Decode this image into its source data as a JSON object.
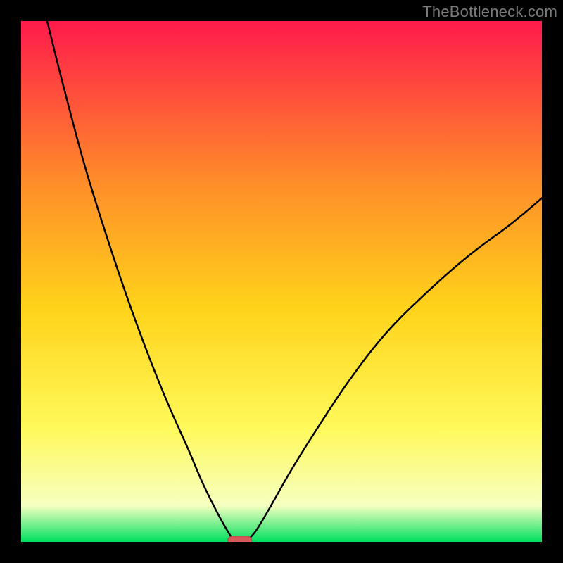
{
  "watermark": "TheBottleneck.com",
  "colors": {
    "gradient_top": "#ff1a4b",
    "gradient_upper_mid": "#ff8a2a",
    "gradient_mid": "#ffd31a",
    "gradient_lower_mid": "#fff95a",
    "gradient_near_bottom": "#f6ffc0",
    "gradient_bottom": "#00e060",
    "curve": "#000000",
    "marker_fill": "#d65a5a",
    "marker_stroke": "#b24848",
    "frame": "#000000"
  },
  "chart_data": {
    "type": "line",
    "title": "",
    "xlabel": "",
    "ylabel": "",
    "xlim": [
      0,
      100
    ],
    "ylim": [
      0,
      100
    ],
    "grid": false,
    "series": [
      {
        "name": "left-branch",
        "x": [
          5,
          8,
          12,
          16,
          20,
          24,
          28,
          32,
          35,
          38,
          40,
          41
        ],
        "y": [
          100,
          88,
          73,
          60,
          48,
          37,
          27,
          18,
          11,
          5,
          1.5,
          0
        ]
      },
      {
        "name": "right-branch",
        "x": [
          43,
          45,
          48,
          52,
          57,
          63,
          70,
          78,
          86,
          94,
          100
        ],
        "y": [
          0,
          2,
          7,
          14,
          22,
          31,
          40,
          48,
          55,
          61,
          66
        ]
      }
    ],
    "marker": {
      "x": 42,
      "y": 0,
      "label": ""
    },
    "annotations": []
  }
}
